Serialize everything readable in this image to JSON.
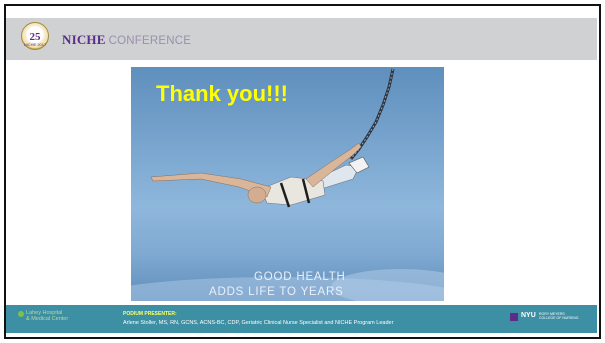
{
  "header": {
    "badge_number": "25",
    "badge_text": "NICHE 2017",
    "brand_niche": "NICHE",
    "brand_conference": "CONFERENCE"
  },
  "slide": {
    "title": "Thank you!!!",
    "caption_line1": "GOOD HEALTH",
    "caption_line2": "ADDS LIFE TO YEARS"
  },
  "footer": {
    "hospital_line1": "Lahey Hospital",
    "hospital_line2": "& Medical Center",
    "presenter_label": "PODIUM PRESENTER:",
    "presenter_name": "Arlene Stoller, MS, RN, GCNS, ACNS-BC, CDP, Geriatric Clinical Nurse Specialist and NICHE Program Leader",
    "nyu_logo": "NYU",
    "nyu_school_line1": "RORY MEYERS",
    "nyu_school_line2": "COLLEGE OF NURSING"
  },
  "colors": {
    "header_bg": "#d0d1d3",
    "footer_bg": "#3d8fa4",
    "niche_purple": "#5b2c89",
    "title_yellow": "#ffff00"
  }
}
